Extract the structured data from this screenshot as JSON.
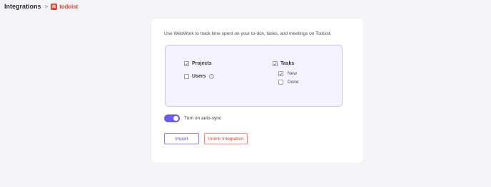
{
  "breadcrumb": {
    "root": "Integrations",
    "separator": ">",
    "brand": "todoist"
  },
  "card": {
    "description": "Use WebWork to track time spent on your to-dos, tasks, and meetings on Todoist.",
    "options": {
      "projects": {
        "label": "Projects",
        "checked": true
      },
      "users": {
        "label": "Users",
        "checked": false,
        "info_icon": "info-icon"
      },
      "tasks": {
        "label": "Tasks",
        "checked": true
      },
      "new": {
        "label": "New",
        "checked": true
      },
      "done": {
        "label": "Done",
        "checked": false
      }
    },
    "auto_sync": {
      "label": "Turn on auto-sync",
      "enabled": true
    },
    "buttons": {
      "import": "Import",
      "unlink": "Unlink Integration"
    }
  },
  "colors": {
    "accent": "#6b5cf0",
    "danger": "#e2463c",
    "brand": "#e44332",
    "panel_bg": "#f5f3ff"
  }
}
